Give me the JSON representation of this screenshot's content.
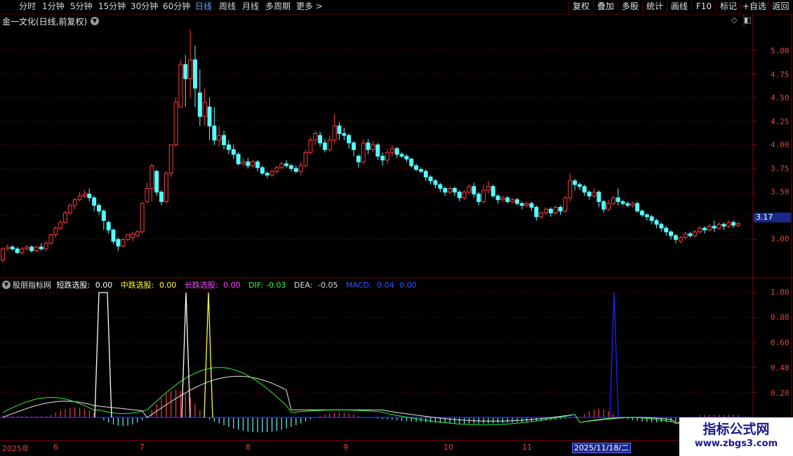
{
  "toolbar": {
    "periods": [
      "分时",
      "1分钟",
      "5分钟",
      "15分钟",
      "30分钟",
      "60分钟",
      "日线",
      "周线",
      "月线",
      "多周期",
      "更多 >"
    ],
    "active_period": "日线",
    "right_buttons": [
      "复权",
      "叠加",
      "多股",
      "统计",
      "画线",
      "F10",
      "标记",
      "+自选",
      "返回"
    ]
  },
  "main_chart": {
    "title": "金一文化(日线,前复权)",
    "y_ticks": [
      "5.00",
      "4.75",
      "4.50",
      "4.25",
      "4.00",
      "3.75",
      "3.50",
      "3.00"
    ],
    "current_price": "3.17"
  },
  "indicator": {
    "name": "股朋指标网",
    "items": [
      {
        "label": "短跌选股:",
        "value": "0.00",
        "color": "#ffffff"
      },
      {
        "label": "中跌选股:",
        "value": "0.00",
        "color": "#ffff33"
      },
      {
        "label": "长跌选股:",
        "value": "0.00",
        "color": "#ff44ff"
      },
      {
        "label": "DIF:",
        "value": "-0.03",
        "color": "#33ff33"
      },
      {
        "label": "DEA:",
        "value": "-0.05",
        "color": "#dddddd"
      },
      {
        "label": "MACD:",
        "value": "0.04",
        "color": "#3333ff"
      }
    ],
    "tail": "0.00",
    "y_ticks": [
      "1.00",
      "0.80",
      "0.60",
      "0.40",
      "0.20"
    ]
  },
  "x_axis": {
    "labels": [
      "2025年",
      "6",
      "7",
      "8",
      "9",
      "10",
      "11"
    ],
    "cursor_date": "2025/11/18/二"
  },
  "watermark": {
    "line1": "指标公式网",
    "line2": "www.zbgs3.com"
  },
  "chart_data": {
    "type": "candlestick",
    "title": "金一文化(日线,前复权)",
    "ylim": [
      2.75,
      5.25
    ],
    "candles": [
      [
        2.78,
        2.9,
        2.76,
        2.92
      ],
      [
        2.9,
        2.92,
        2.88,
        2.95
      ],
      [
        2.92,
        2.9,
        2.88,
        2.94
      ],
      [
        2.9,
        2.86,
        2.85,
        2.92
      ],
      [
        2.86,
        2.9,
        2.84,
        2.92
      ],
      [
        2.9,
        2.92,
        2.88,
        2.94
      ],
      [
        2.92,
        2.88,
        2.86,
        2.94
      ],
      [
        2.88,
        2.92,
        2.86,
        2.94
      ],
      [
        2.92,
        2.9,
        2.88,
        2.96
      ],
      [
        2.9,
        2.96,
        2.88,
        2.98
      ],
      [
        2.96,
        3.05,
        2.94,
        3.06
      ],
      [
        3.05,
        3.12,
        3.02,
        3.14
      ],
      [
        3.12,
        3.18,
        3.1,
        3.2
      ],
      [
        3.18,
        3.28,
        3.16,
        3.3
      ],
      [
        3.28,
        3.36,
        3.26,
        3.38
      ],
      [
        3.36,
        3.42,
        3.32,
        3.44
      ],
      [
        3.42,
        3.46,
        3.4,
        3.5
      ],
      [
        3.46,
        3.48,
        3.44,
        3.52
      ],
      [
        3.48,
        3.44,
        3.4,
        3.54
      ],
      [
        3.44,
        3.36,
        3.3,
        3.46
      ],
      [
        3.36,
        3.3,
        3.26,
        3.38
      ],
      [
        3.3,
        3.2,
        3.1,
        3.32
      ],
      [
        3.18,
        3.1,
        3.06,
        3.2
      ],
      [
        3.1,
        2.98,
        2.95,
        3.12
      ],
      [
        3.0,
        2.93,
        2.88,
        3.02
      ],
      [
        2.93,
        3.0,
        2.92,
        3.02
      ],
      [
        3.0,
        3.05,
        2.98,
        3.06
      ],
      [
        3.02,
        3.06,
        2.98,
        3.08
      ],
      [
        3.04,
        3.08,
        3.02,
        3.1
      ],
      [
        3.08,
        3.38,
        3.06,
        3.4
      ],
      [
        3.4,
        3.54,
        3.38,
        3.6
      ],
      [
        3.54,
        3.78,
        3.4,
        3.8
      ],
      [
        3.72,
        3.5,
        3.46,
        3.74
      ],
      [
        3.5,
        3.4,
        3.36,
        3.52
      ],
      [
        3.4,
        3.7,
        3.38,
        3.72
      ],
      [
        3.7,
        4.0,
        3.66,
        4.0
      ],
      [
        4.0,
        4.45,
        3.98,
        4.5
      ],
      [
        4.4,
        4.85,
        4.4,
        4.9
      ],
      [
        4.85,
        4.7,
        4.4,
        4.95
      ],
      [
        4.7,
        4.9,
        4.5,
        5.22
      ],
      [
        4.9,
        4.6,
        4.4,
        5.05
      ],
      [
        4.55,
        4.3,
        4.2,
        4.8
      ],
      [
        4.3,
        4.45,
        4.2,
        4.6
      ],
      [
        4.4,
        4.2,
        4.05,
        4.5
      ],
      [
        4.2,
        4.05,
        4.0,
        4.4
      ],
      [
        4.05,
        4.1,
        3.98,
        4.2
      ],
      [
        4.1,
        4.0,
        3.95,
        4.15
      ],
      [
        4.0,
        3.95,
        3.9,
        4.05
      ],
      [
        3.95,
        3.9,
        3.85,
        4.0
      ],
      [
        3.9,
        3.8,
        3.78,
        3.92
      ],
      [
        3.8,
        3.82,
        3.78,
        3.86
      ],
      [
        3.82,
        3.78,
        3.75,
        3.86
      ],
      [
        3.78,
        3.82,
        3.76,
        3.84
      ],
      [
        3.82,
        3.76,
        3.72,
        3.84
      ],
      [
        3.76,
        3.7,
        3.68,
        3.78
      ],
      [
        3.7,
        3.68,
        3.65,
        3.72
      ],
      [
        3.68,
        3.72,
        3.66,
        3.74
      ],
      [
        3.72,
        3.76,
        3.7,
        3.78
      ],
      [
        3.76,
        3.8,
        3.74,
        3.82
      ],
      [
        3.8,
        3.78,
        3.76,
        3.84
      ],
      [
        3.78,
        3.75,
        3.72,
        3.8
      ],
      [
        3.75,
        3.72,
        3.7,
        3.78
      ],
      [
        3.72,
        3.78,
        3.68,
        3.82
      ],
      [
        3.78,
        3.92,
        3.76,
        3.95
      ],
      [
        3.92,
        4.05,
        3.9,
        4.08
      ],
      [
        4.05,
        4.12,
        4.0,
        4.15
      ],
      [
        4.1,
        4.02,
        3.98,
        4.14
      ],
      [
        4.02,
        3.95,
        3.92,
        4.06
      ],
      [
        3.95,
        4.05,
        3.92,
        4.1
      ],
      [
        4.05,
        4.2,
        4.02,
        4.33
      ],
      [
        4.2,
        4.12,
        4.05,
        4.24
      ],
      [
        4.12,
        4.1,
        4.05,
        4.18
      ],
      [
        4.1,
        4.02,
        3.96,
        4.12
      ],
      [
        4.02,
        3.95,
        3.88,
        4.04
      ],
      [
        3.88,
        3.82,
        3.76,
        3.9
      ],
      [
        3.82,
        4.02,
        3.8,
        4.06
      ],
      [
        4.02,
        3.95,
        3.9,
        4.06
      ],
      [
        3.95,
        4.0,
        3.92,
        4.04
      ],
      [
        4.0,
        3.88,
        3.84,
        4.02
      ],
      [
        3.88,
        3.84,
        3.78,
        3.92
      ],
      [
        3.84,
        3.92,
        3.8,
        3.96
      ],
      [
        3.92,
        3.96,
        3.88,
        4.0
      ],
      [
        3.96,
        3.9,
        3.86,
        3.98
      ],
      [
        3.9,
        3.88,
        3.86,
        3.92
      ],
      [
        3.88,
        3.85,
        3.82,
        3.9
      ],
      [
        3.85,
        3.78,
        3.76,
        3.86
      ],
      [
        3.78,
        3.74,
        3.72,
        3.8
      ],
      [
        3.74,
        3.72,
        3.7,
        3.76
      ],
      [
        3.72,
        3.66,
        3.62,
        3.74
      ],
      [
        3.66,
        3.62,
        3.58,
        3.68
      ],
      [
        3.62,
        3.58,
        3.54,
        3.64
      ],
      [
        3.58,
        3.54,
        3.5,
        3.6
      ],
      [
        3.54,
        3.5,
        3.46,
        3.56
      ],
      [
        3.5,
        3.54,
        3.48,
        3.56
      ],
      [
        3.54,
        3.5,
        3.46,
        3.56
      ],
      [
        3.5,
        3.44,
        3.4,
        3.52
      ],
      [
        3.44,
        3.5,
        3.42,
        3.52
      ],
      [
        3.5,
        3.56,
        3.48,
        3.58
      ],
      [
        3.56,
        3.48,
        3.44,
        3.6
      ],
      [
        3.48,
        3.4,
        3.36,
        3.5
      ],
      [
        3.4,
        3.52,
        3.38,
        3.58
      ],
      [
        3.52,
        3.56,
        3.48,
        3.62
      ],
      [
        3.56,
        3.46,
        3.44,
        3.58
      ],
      [
        3.46,
        3.42,
        3.38,
        3.48
      ],
      [
        3.42,
        3.44,
        3.4,
        3.46
      ],
      [
        3.44,
        3.4,
        3.38,
        3.46
      ],
      [
        3.4,
        3.42,
        3.38,
        3.44
      ],
      [
        3.42,
        3.38,
        3.36,
        3.44
      ],
      [
        3.38,
        3.36,
        3.32,
        3.4
      ],
      [
        3.36,
        3.38,
        3.34,
        3.4
      ],
      [
        3.38,
        3.34,
        3.3,
        3.4
      ],
      [
        3.34,
        3.24,
        3.2,
        3.36
      ],
      [
        3.24,
        3.28,
        3.22,
        3.3
      ],
      [
        3.28,
        3.32,
        3.26,
        3.34
      ],
      [
        3.32,
        3.28,
        3.24,
        3.34
      ],
      [
        3.28,
        3.34,
        3.26,
        3.36
      ],
      [
        3.34,
        3.3,
        3.26,
        3.36
      ],
      [
        3.3,
        3.44,
        3.28,
        3.46
      ],
      [
        3.44,
        3.62,
        3.4,
        3.7
      ],
      [
        3.62,
        3.58,
        3.52,
        3.64
      ],
      [
        3.58,
        3.56,
        3.52,
        3.6
      ],
      [
        3.56,
        3.5,
        3.46,
        3.58
      ],
      [
        3.5,
        3.46,
        3.42,
        3.52
      ],
      [
        3.46,
        3.5,
        3.44,
        3.54
      ],
      [
        3.5,
        3.4,
        3.34,
        3.52
      ],
      [
        3.4,
        3.32,
        3.28,
        3.42
      ],
      [
        3.32,
        3.38,
        3.3,
        3.42
      ],
      [
        3.38,
        3.44,
        3.36,
        3.46
      ],
      [
        3.44,
        3.4,
        3.36,
        3.54
      ],
      [
        3.4,
        3.38,
        3.36,
        3.42
      ],
      [
        3.38,
        3.36,
        3.34,
        3.4
      ],
      [
        3.36,
        3.38,
        3.34,
        3.4
      ],
      [
        3.38,
        3.3,
        3.28,
        3.4
      ],
      [
        3.3,
        3.26,
        3.24,
        3.32
      ],
      [
        3.26,
        3.24,
        3.2,
        3.28
      ],
      [
        3.24,
        3.2,
        3.16,
        3.26
      ],
      [
        3.2,
        3.16,
        3.12,
        3.22
      ],
      [
        3.16,
        3.12,
        3.08,
        3.18
      ],
      [
        3.12,
        3.08,
        3.04,
        3.14
      ],
      [
        3.08,
        3.04,
        3.0,
        3.1
      ],
      [
        3.04,
        3.0,
        2.96,
        3.06
      ],
      [
        2.98,
        3.02,
        2.96,
        3.04
      ],
      [
        3.02,
        3.06,
        3.0,
        3.08
      ],
      [
        3.06,
        3.04,
        3.02,
        3.08
      ],
      [
        3.04,
        3.08,
        3.02,
        3.1
      ],
      [
        3.08,
        3.12,
        3.06,
        3.14
      ],
      [
        3.12,
        3.1,
        3.06,
        3.14
      ],
      [
        3.1,
        3.14,
        3.08,
        3.16
      ],
      [
        3.14,
        3.12,
        3.08,
        3.2
      ],
      [
        3.12,
        3.16,
        3.1,
        3.18
      ],
      [
        3.16,
        3.14,
        3.1,
        3.18
      ],
      [
        3.14,
        3.18,
        3.12,
        3.2
      ],
      [
        3.18,
        3.15,
        3.12,
        3.2
      ],
      [
        3.15,
        3.17,
        3.13,
        3.19
      ]
    ]
  }
}
